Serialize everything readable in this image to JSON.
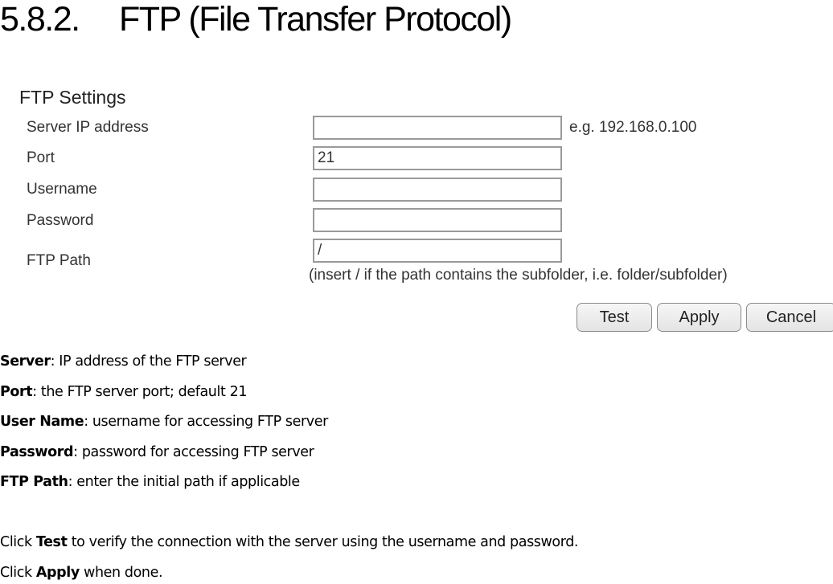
{
  "heading": {
    "number": "5.8.2.",
    "title": "FTP (File Transfer Protocol)"
  },
  "ftp_settings": {
    "title": "FTP Settings",
    "fields": [
      {
        "label": "Server IP address",
        "value": "",
        "hint": "e.g. 192.168.0.100"
      },
      {
        "label": "Port",
        "value": "21"
      },
      {
        "label": "Username",
        "value": ""
      },
      {
        "label": "Password",
        "value": ""
      },
      {
        "label": "FTP Path",
        "value": "/"
      }
    ],
    "path_note": "(insert / if the path contains the subfolder, i.e. folder/subfolder)",
    "buttons": {
      "test": "Test",
      "apply": "Apply",
      "cancel": "Cancel"
    }
  },
  "descriptions": [
    {
      "term": "Server",
      "text": ": IP address of the FTP server"
    },
    {
      "term": "Port",
      "text": ": the FTP server port; default 21"
    },
    {
      "term": "User Name",
      "text": ": username for accessing FTP server"
    },
    {
      "term": "Password",
      "text": ": password for accessing FTP server"
    },
    {
      "term": "FTP Path",
      "text": ": enter the initial path if applicable"
    }
  ],
  "instructions": [
    {
      "prefix": "Click ",
      "bold": "Test",
      "suffix": " to verify the connection with the server using the username and password."
    },
    {
      "prefix": "Click ",
      "bold": "Apply",
      "suffix": " when done."
    }
  ]
}
